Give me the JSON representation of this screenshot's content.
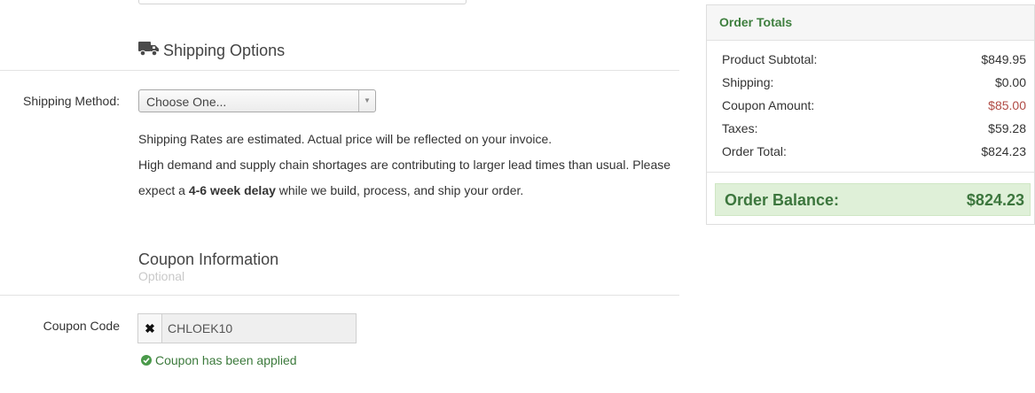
{
  "shipping": {
    "title": "Shipping Options",
    "icon": "truck-icon",
    "method_label": "Shipping Method:",
    "method_value": "Choose One...",
    "notes": {
      "line1": "Shipping Rates are estimated. Actual price will be reflected on your invoice.",
      "line2": "High demand and supply chain shortages are contributing to larger lead times than usual. Please",
      "line3_before": "expect a ",
      "line3_bold": "4-6 week delay",
      "line3_after": " while we build, process, and ship your order."
    }
  },
  "coupon": {
    "title": "Coupon Information",
    "subtitle": "Optional",
    "code_label": "Coupon Code",
    "code_value": "CHLOEK10",
    "clear_glyph": "✖",
    "status": "Coupon has been applied"
  },
  "totals": {
    "title": "Order Totals",
    "rows": [
      {
        "label": "Product Subtotal:",
        "value": "$849.95"
      },
      {
        "label": "Shipping:",
        "value": "$0.00"
      },
      {
        "label": "Coupon Amount:",
        "value": "$85.00"
      },
      {
        "label": "Taxes:",
        "value": "$59.28"
      },
      {
        "label": "Order Total:",
        "value": "$824.23"
      }
    ],
    "balance_label": "Order Balance:",
    "balance_value": "$824.23"
  },
  "colors": {
    "accent_green": "#3e7f3e",
    "discount_red": "#b04b45",
    "balance_bg": "#dff0d8"
  }
}
